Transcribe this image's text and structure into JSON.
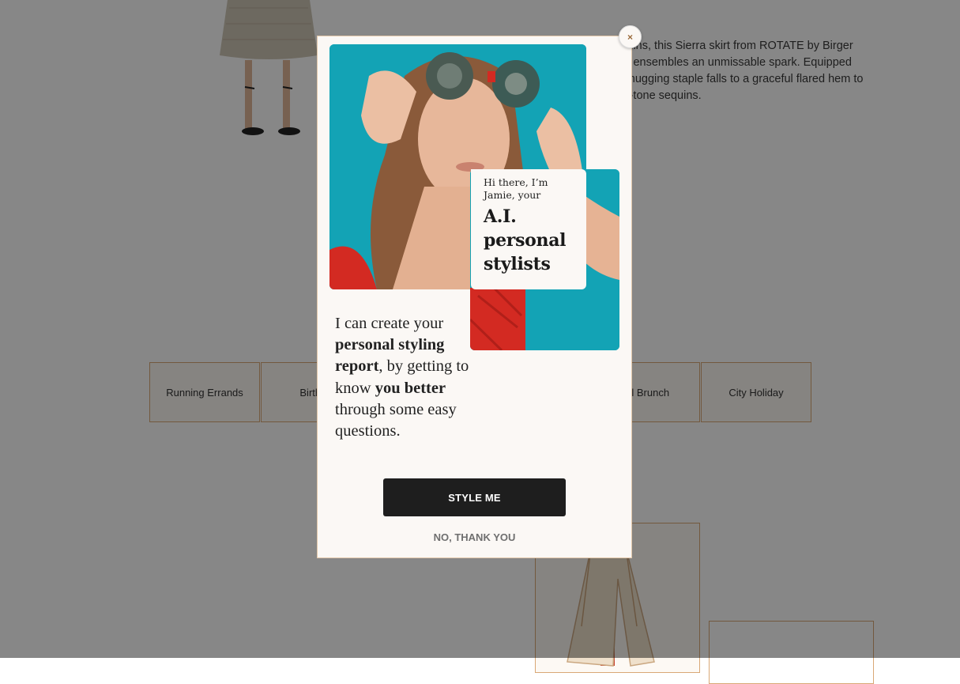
{
  "product": {
    "description_lines": [
      "sequins, this Sierra skirt from ROTATE by Birger",
      "ning ensembles an unmissable spark. Equipped",
      "ure-hugging staple falls to a graceful flared hem to",
      "ilver-tone sequins."
    ]
  },
  "occasions": [
    "Running Errands",
    "Birthda",
    "ual Brunch",
    "City Holiday"
  ],
  "modal": {
    "close_label": "×",
    "intro_small": "Hi there, I’m Jamie, your",
    "intro_big_lines": [
      "A.I.",
      "personal",
      "stylists"
    ],
    "body": {
      "p1": "I can create your ",
      "b1": "personal styling report",
      "p2": ", by getting to know ",
      "b2": "you better",
      "p3": " through some easy questions."
    },
    "primary_button": "STYLE ME",
    "secondary_link": "NO, THANK YOU"
  },
  "colors": {
    "photo_background": "#13a3b5",
    "dress_red": "#d32a22",
    "tile_border": "#d9a876",
    "button_dark": "#1e1e1e"
  },
  "icons": [
    "close-icon"
  ]
}
